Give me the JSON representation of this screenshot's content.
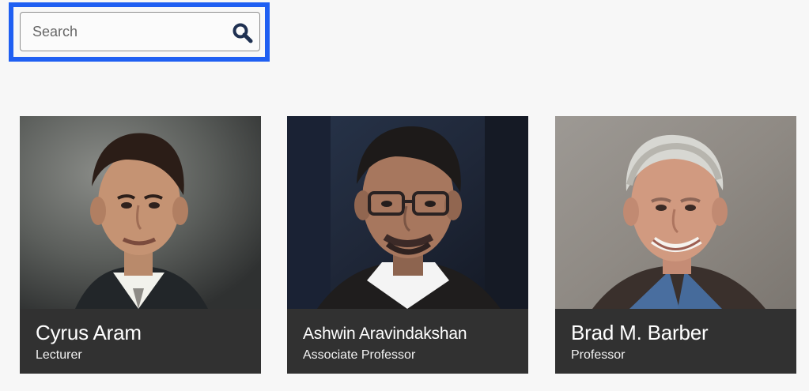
{
  "search": {
    "placeholder": "Search",
    "icon": "search-icon"
  },
  "people": [
    {
      "name": "Cyrus Aram",
      "title": "Lecturer"
    },
    {
      "name": "Ashwin Aravindakshan",
      "title": "Associate Professor"
    },
    {
      "name": "Brad M. Barber",
      "title": "Professor"
    }
  ],
  "colors": {
    "focus_ring": "#1f5ff2",
    "caption_bg": "#313131",
    "page_bg": "#f7f7f7",
    "search_icon": "#1f3152"
  }
}
